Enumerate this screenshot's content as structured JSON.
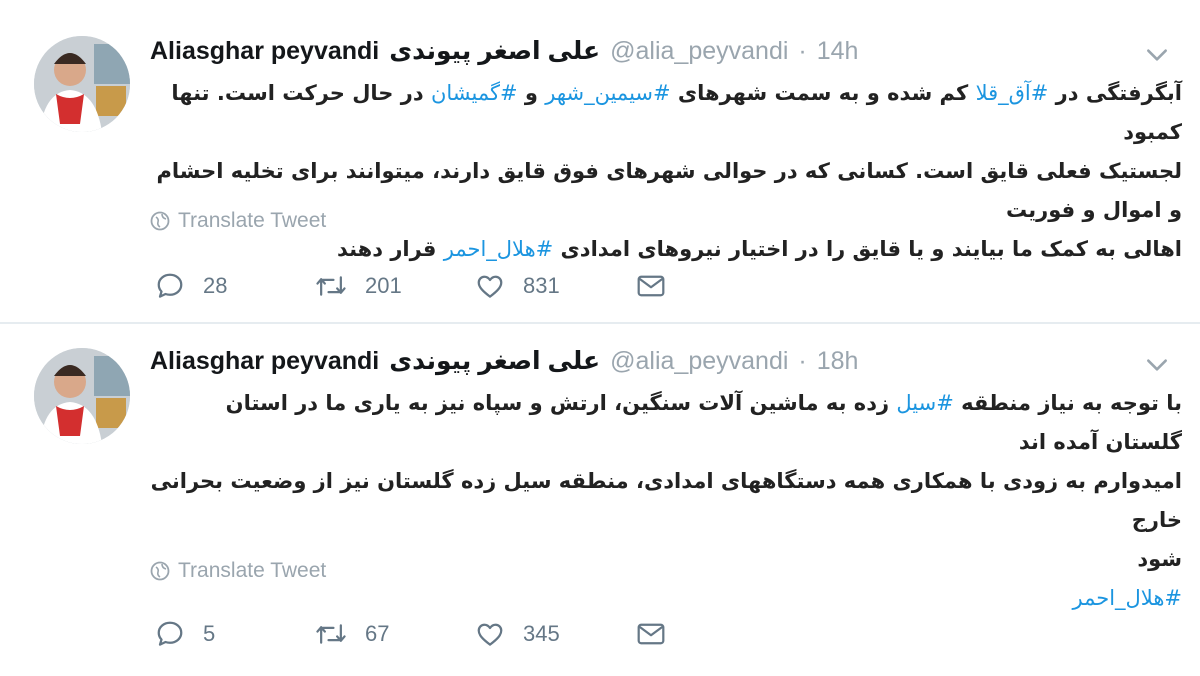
{
  "tweets": [
    {
      "name": "Aliasghar peyvandi",
      "name_fa": "علی اصغر پیوندی",
      "handle": "@alia_peyvandi",
      "separator": "·",
      "time": "14h",
      "body_lines": [
        [
          {
            "t": "آبگرفتگی در "
          },
          {
            "t": "#آق_قلا",
            "tag": true
          },
          {
            "t": " کم شده و به سمت شهرهای "
          },
          {
            "t": "#سیمین_شهر",
            "tag": true
          },
          {
            "t": " و "
          },
          {
            "t": "#گمیشان",
            "tag": true
          },
          {
            "t": " در حال حرکت است. تنها کمبود"
          }
        ],
        [
          {
            "t": "لجستیک فعلی قایق است. کسانی که در حوالی شهرهای فوق قایق دارند، میتوانند برای تخلیه احشام و اموال و فوریت"
          }
        ],
        [
          {
            "t": "اهالی به کمک ما بیایند و یا قایق را در اختیار نیروهای امدادی "
          },
          {
            "t": "#هلال_احمر",
            "tag": true
          },
          {
            "t": " قرار دهند"
          }
        ]
      ],
      "translate_label": "Translate Tweet",
      "replies": "28",
      "retweets": "201",
      "likes": "831"
    },
    {
      "name": "Aliasghar peyvandi",
      "name_fa": "علی اصغر پیوندی",
      "handle": "@alia_peyvandi",
      "separator": "·",
      "time": "18h",
      "body_lines": [
        [
          {
            "t": "با توجه به نیاز منطقه "
          },
          {
            "t": "#سیل",
            "tag": true
          },
          {
            "t": " زده به ماشین آلات سنگین، ارتش و سپاه نیز به یاری ما در استان گلستان آمده اند"
          }
        ],
        [
          {
            "t": "امیدوارم به زودی با همکاری همه دستگاههای امدادی، منطقه سیل زده گلستان نیز از وضعیت بحرانی خارج"
          }
        ],
        [
          {
            "t": "شود"
          }
        ],
        [
          {
            "t": "#هلال_احمر",
            "tag": true
          }
        ]
      ],
      "translate_label": "Translate Tweet",
      "replies": "5",
      "retweets": "67",
      "likes": "345"
    }
  ],
  "colors": {
    "hashtag": "#1b95e0",
    "muted": "#9aa5ae",
    "icon": "#657786",
    "divider": "#e6ecf0"
  },
  "icons": [
    "avatar",
    "chevron-down-icon",
    "globe-icon",
    "reply-icon",
    "retweet-icon",
    "like-icon",
    "dm-icon"
  ]
}
